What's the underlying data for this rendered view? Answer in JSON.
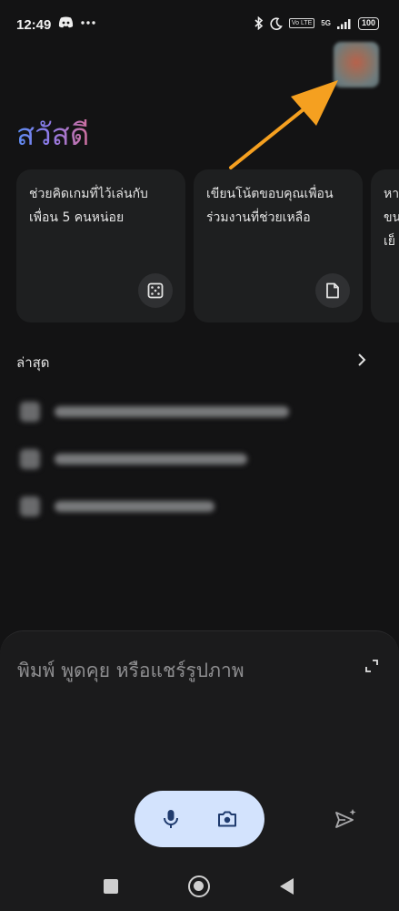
{
  "status_bar": {
    "time": "12:49",
    "volte": "Vo LTE",
    "network": "5G",
    "battery": "100"
  },
  "greeting": "สวัสดี",
  "suggestions": [
    {
      "text": "ช่วยคิดเกมที่ไว้เล่นกับเพื่อน 5 คนหน่อย",
      "icon": "dice-icon"
    },
    {
      "text": "เขียนโน้ตขอบคุณเพื่อนร่วมงานที่ช่วยเหลือ",
      "icon": "document-icon"
    },
    {
      "text": "หา ขน เย็",
      "icon": "unknown-icon"
    }
  ],
  "recent": {
    "title": "ล่าสุด"
  },
  "input": {
    "placeholder": "พิมพ์ พูดคุย หรือแชร์รูปภาพ"
  },
  "colors": {
    "background": "#131314",
    "card": "#1e1f20",
    "pill": "#d3e3fd",
    "arrow": "#f5a020"
  }
}
